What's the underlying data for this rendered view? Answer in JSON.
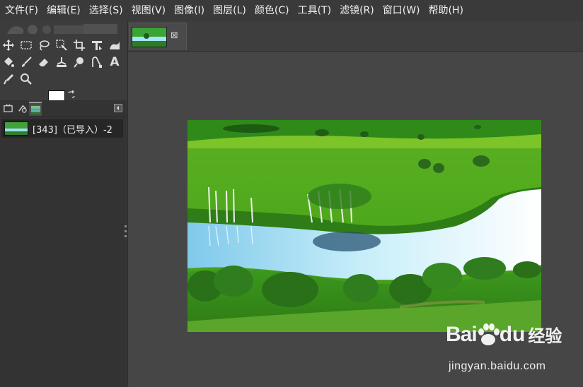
{
  "menu": {
    "items": [
      "文件(F)",
      "编辑(E)",
      "选择(S)",
      "视图(V)",
      "图像(I)",
      "图层(L)",
      "颜色(C)",
      "工具(T)",
      "滤镜(R)",
      "窗口(W)",
      "帮助(H)"
    ]
  },
  "toolbox": {
    "tools_row1": [
      "move-tool-icon",
      "rect-select-icon",
      "lasso-icon",
      "fuzzy-select-icon",
      "crop-icon",
      "transform-icon",
      "warp-icon"
    ],
    "tools_row2": [
      "bucket-fill-icon",
      "paintbrush-icon",
      "eraser-icon",
      "clone-icon",
      "smudge-icon",
      "paths-icon",
      "text-icon"
    ],
    "tools_row3": [
      "color-picker-icon",
      "zoom-icon"
    ],
    "text_tool_glyph": "A",
    "foreground_color": "#ffffff",
    "background_color": "#ffffff"
  },
  "layers": {
    "items": [
      {
        "name": "[343]（已导入）-2"
      }
    ]
  },
  "image_tab": {
    "close_glyph": "⊠"
  },
  "watermark": {
    "bai": "Bai",
    "du": "du",
    "jingyan": "经验",
    "url": "jingyan.baidu.com"
  },
  "colors": {
    "menubar_bg": "#3a3a3a",
    "panel_bg": "#3c3c3c",
    "canvas_bg": "#464646"
  }
}
